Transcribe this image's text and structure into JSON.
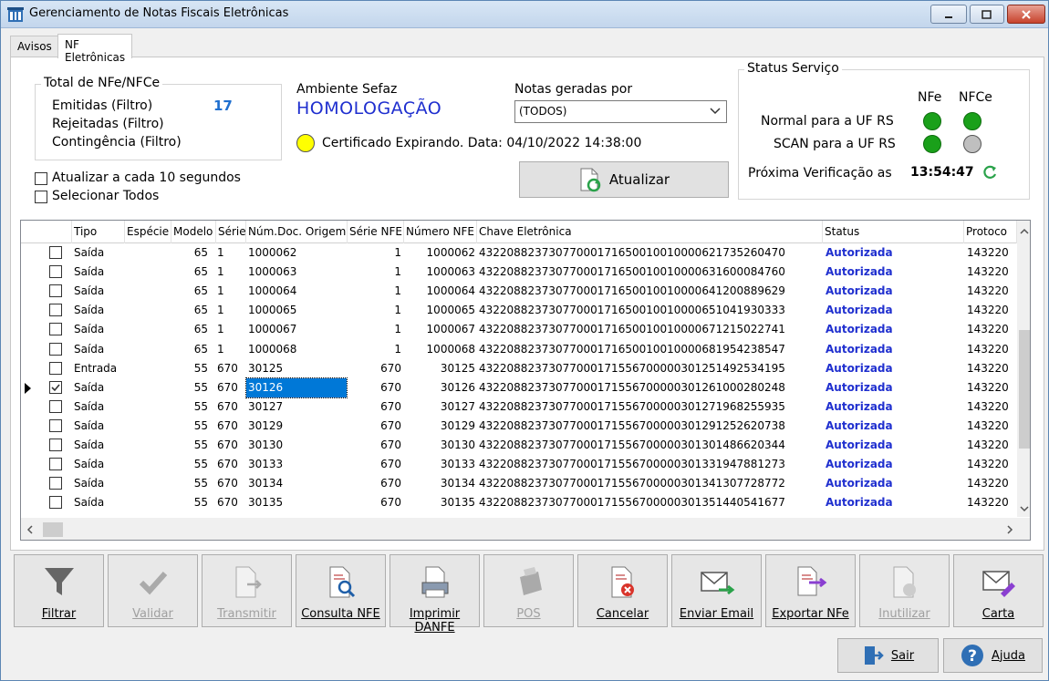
{
  "window": {
    "title": "Gerenciamento de Notas Fiscais Eletrônicas"
  },
  "tabs": [
    {
      "label": "Avisos"
    },
    {
      "label": "NF Eletrônicas"
    }
  ],
  "totals": {
    "legend": "Total de NFe/NFCe",
    "emitidas_label": "Emitidas (Filtro)",
    "emitidas_value": "17",
    "rejeitadas_label": "Rejeitadas (Filtro)",
    "contingencia_label": "Contingência (Filtro)"
  },
  "ambiente": {
    "label": "Ambiente Sefaz",
    "value": "HOMOLOGAÇÃO",
    "color": "#1f2fcf"
  },
  "certificado": {
    "text": "Certificado Expirando. Data: 04/10/2022 14:38:00",
    "led_color": "#ffff00"
  },
  "notas_geradas": {
    "label": "Notas geradas por",
    "selected": "(TODOS)"
  },
  "options": {
    "auto_refresh": "Atualizar a cada 10 segundos",
    "select_all": "Selecionar Todos"
  },
  "atualizar_label": "Atualizar",
  "status_servico": {
    "legend": "Status Serviço",
    "col_nfe": "NFe",
    "col_nfce": "NFCe",
    "rows": [
      {
        "label": "Normal para a UF RS",
        "nfe": "#1aa01a",
        "nfce": "#1aa01a"
      },
      {
        "label": "SCAN para a UF RS",
        "nfe": "#1aa01a",
        "nfce": "#bfbfbf"
      }
    ],
    "proxima_label": "Próxima Verificação as",
    "proxima_time": "13:54:47"
  },
  "grid": {
    "headers": [
      "Tipo",
      "Espécie",
      "Modelo",
      "Série",
      "Núm.Doc. Origem",
      "Série NFE",
      "Número NFE",
      "Chave Eletrônica",
      "Status",
      "Protoco"
    ],
    "rows": [
      {
        "tipo": "Saída",
        "especie": "",
        "modelo": "65",
        "serie": "1",
        "numdoc": "1000062",
        "serienfe": "1",
        "numnfe": "1000062",
        "chave": "43220882373077000171650010010000621735260470",
        "status": "Autorizada",
        "protocolo": "143220",
        "checked": false
      },
      {
        "tipo": "Saída",
        "especie": "",
        "modelo": "65",
        "serie": "1",
        "numdoc": "1000063",
        "serienfe": "1",
        "numnfe": "1000063",
        "chave": "43220882373077000171650010010000631600084760",
        "status": "Autorizada",
        "protocolo": "143220",
        "checked": false
      },
      {
        "tipo": "Saída",
        "especie": "",
        "modelo": "65",
        "serie": "1",
        "numdoc": "1000064",
        "serienfe": "1",
        "numnfe": "1000064",
        "chave": "43220882373077000171650010010000641200889629",
        "status": "Autorizada",
        "protocolo": "143220",
        "checked": false
      },
      {
        "tipo": "Saída",
        "especie": "",
        "modelo": "65",
        "serie": "1",
        "numdoc": "1000065",
        "serienfe": "1",
        "numnfe": "1000065",
        "chave": "43220882373077000171650010010000651041930333",
        "status": "Autorizada",
        "protocolo": "143220",
        "checked": false
      },
      {
        "tipo": "Saída",
        "especie": "",
        "modelo": "65",
        "serie": "1",
        "numdoc": "1000067",
        "serienfe": "1",
        "numnfe": "1000067",
        "chave": "43220882373077000171650010010000671215022741",
        "status": "Autorizada",
        "protocolo": "143220",
        "checked": false
      },
      {
        "tipo": "Saída",
        "especie": "",
        "modelo": "65",
        "serie": "1",
        "numdoc": "1000068",
        "serienfe": "1",
        "numnfe": "1000068",
        "chave": "43220882373077000171650010010000681954238547",
        "status": "Autorizada",
        "protocolo": "143220",
        "checked": false
      },
      {
        "tipo": "Entrada",
        "especie": "",
        "modelo": "55",
        "serie": "670",
        "numdoc": "30125",
        "serienfe": "670",
        "numnfe": "30125",
        "chave": "43220882373077000171556700000301251492534195",
        "status": "Autorizada",
        "protocolo": "143220",
        "checked": false
      },
      {
        "tipo": "Saída",
        "especie": "",
        "modelo": "55",
        "serie": "670",
        "numdoc": "30126",
        "serienfe": "670",
        "numnfe": "30126",
        "chave": "43220882373077000171556700000301261000280248",
        "status": "Autorizada",
        "protocolo": "143220",
        "checked": true,
        "current": true
      },
      {
        "tipo": "Saída",
        "especie": "",
        "modelo": "55",
        "serie": "670",
        "numdoc": "30127",
        "serienfe": "670",
        "numnfe": "30127",
        "chave": "43220882373077000171556700000301271968255935",
        "status": "Autorizada",
        "protocolo": "143220",
        "checked": false
      },
      {
        "tipo": "Saída",
        "especie": "",
        "modelo": "55",
        "serie": "670",
        "numdoc": "30129",
        "serienfe": "670",
        "numnfe": "30129",
        "chave": "43220882373077000171556700000301291252620738",
        "status": "Autorizada",
        "protocolo": "143220",
        "checked": false
      },
      {
        "tipo": "Saída",
        "especie": "",
        "modelo": "55",
        "serie": "670",
        "numdoc": "30130",
        "serienfe": "670",
        "numnfe": "30130",
        "chave": "43220882373077000171556700000301301486620344",
        "status": "Autorizada",
        "protocolo": "143220",
        "checked": false
      },
      {
        "tipo": "Saída",
        "especie": "",
        "modelo": "55",
        "serie": "670",
        "numdoc": "30133",
        "serienfe": "670",
        "numnfe": "30133",
        "chave": "43220882373077000171556700000301331947881273",
        "status": "Autorizada",
        "protocolo": "143220",
        "checked": false
      },
      {
        "tipo": "Saída",
        "especie": "",
        "modelo": "55",
        "serie": "670",
        "numdoc": "30134",
        "serienfe": "670",
        "numnfe": "30134",
        "chave": "43220882373077000171556700000301341307728772",
        "status": "Autorizada",
        "protocolo": "143220",
        "checked": false
      },
      {
        "tipo": "Saída",
        "especie": "",
        "modelo": "55",
        "serie": "670",
        "numdoc": "30135",
        "serienfe": "670",
        "numnfe": "30135",
        "chave": "43220882373077000171556700000301351440541677",
        "status": "Autorizada",
        "protocolo": "143220",
        "checked": false
      }
    ]
  },
  "toolbar": [
    {
      "label": "Filtrar",
      "icon": "funnel-icon",
      "enabled": true
    },
    {
      "label": "Validar",
      "icon": "check-icon",
      "enabled": false
    },
    {
      "label": "Transmitir",
      "icon": "transmit-document-icon",
      "enabled": false
    },
    {
      "label": "Consulta NFE",
      "icon": "search-document-icon",
      "enabled": true
    },
    {
      "label": "Imprimir DANFE",
      "icon": "printer-document-icon",
      "enabled": true
    },
    {
      "label": "POS",
      "icon": "pos-terminal-icon",
      "enabled": false
    },
    {
      "label": "Cancelar",
      "icon": "cancel-document-icon",
      "enabled": true
    },
    {
      "label": "Enviar Email",
      "icon": "send-email-icon",
      "enabled": true
    },
    {
      "label": "Exportar NFe",
      "icon": "export-document-icon",
      "enabled": true
    },
    {
      "label": "Inutilizar",
      "icon": "void-document-icon",
      "enabled": false
    },
    {
      "label": "Carta",
      "icon": "letter-icon",
      "enabled": true
    }
  ],
  "footer": {
    "sair": "Sair",
    "ajuda": "Ajuda"
  }
}
